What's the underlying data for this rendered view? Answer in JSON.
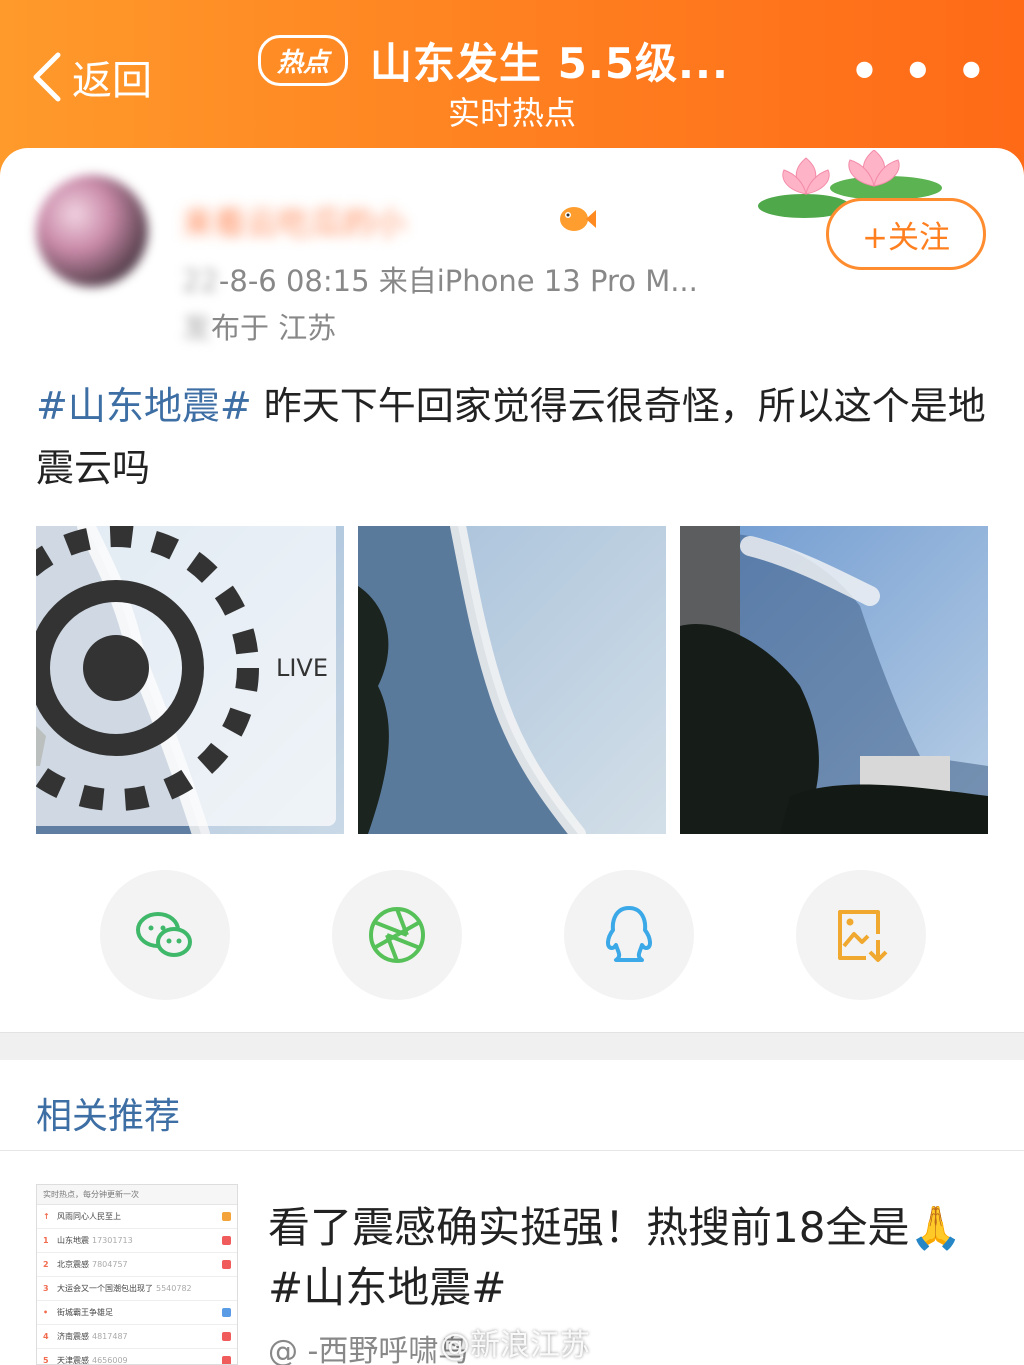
{
  "header": {
    "back_label": "返回",
    "hot_badge": "热点",
    "title": "山东发生 5.5级...",
    "subtitle": "实时热点",
    "more_label": "• • •"
  },
  "post": {
    "username": "来看云吃瓜的小",
    "meta_blurred": "22",
    "meta": "-8-6 08:15  来自iPhone 13 Pro M...",
    "location_blurred": "发",
    "location": "布于 江苏",
    "follow_label": "+关注",
    "hashtag": "#山东地震#",
    "text": " 昨天下午回家觉得云很奇怪，所以这个是地震云吗",
    "live_label": "LIVE"
  },
  "share": {
    "icons": [
      "wechat-icon",
      "moments-icon",
      "qq-icon",
      "save-image-icon"
    ],
    "colors": {
      "wechat": "#3fb86a",
      "moments": "#57c159",
      "qq": "#3ba8e8",
      "save": "#f0a92e"
    }
  },
  "related": {
    "section_title": "相关推荐",
    "thumb_header": "实时热点，每分钟更新一次",
    "thumb_rows": [
      {
        "rank": "↑",
        "name": "风雨同心人民至上",
        "count": "",
        "tag": "o"
      },
      {
        "rank": "1",
        "name": "山东地震",
        "count": "17301713",
        "tag": "r"
      },
      {
        "rank": "2",
        "name": "北京震感",
        "count": "7804757",
        "tag": "r"
      },
      {
        "rank": "3",
        "name": "大运会又一个国潮包出现了",
        "count": "5540782",
        "tag": ""
      },
      {
        "rank": "•",
        "name": "街城霸王争雄足",
        "count": "",
        "tag": "b"
      },
      {
        "rank": "4",
        "name": "济南震感",
        "count": "4817487",
        "tag": "r"
      },
      {
        "rank": "5",
        "name": "天津震感",
        "count": "4656009",
        "tag": "r"
      }
    ],
    "title": "看了震感确实挺强！热搜前18全是🙏#山东地震#",
    "author": "@ -西野呼啸鸟",
    "watermark": "@新浪江苏"
  },
  "colors": {
    "header_start": "#ff9a2b",
    "header_end": "#ff6a17",
    "hashtag": "#3d6ea4",
    "follow": "#ff7f1f"
  }
}
